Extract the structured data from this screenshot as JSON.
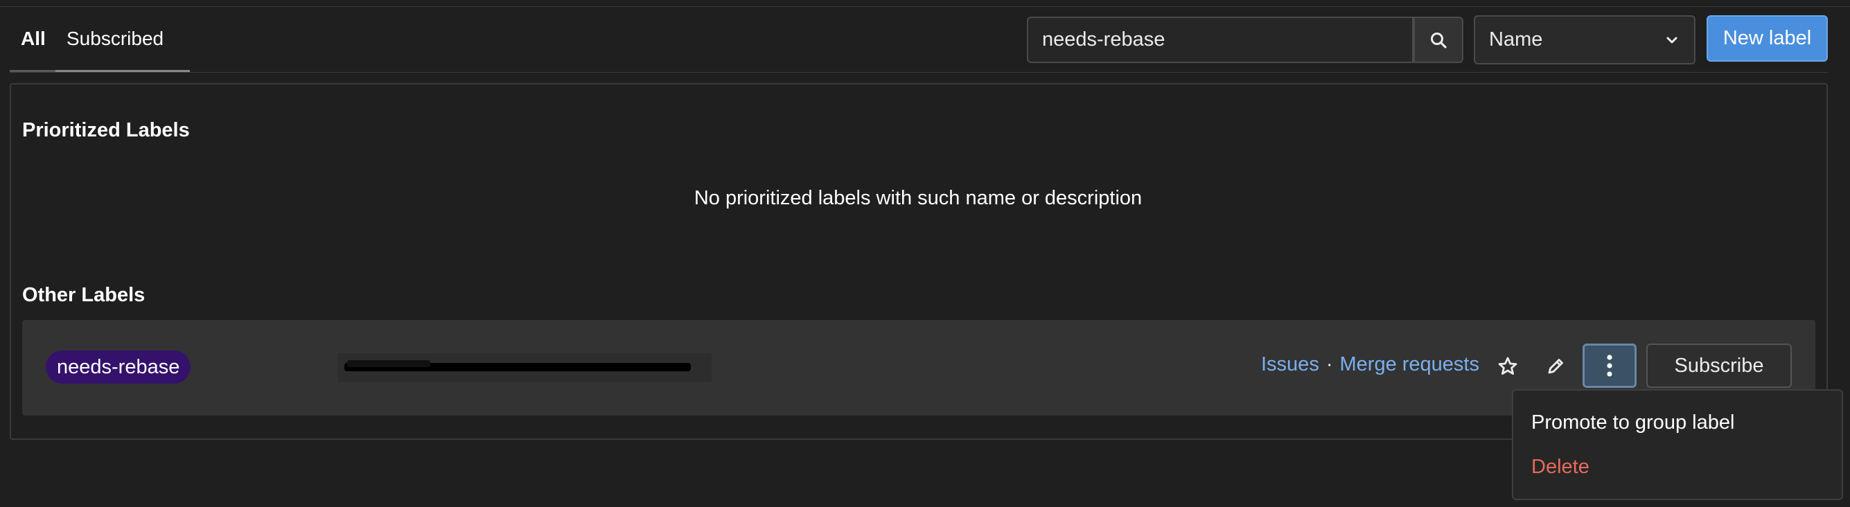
{
  "tabs": {
    "all": "All",
    "subscribed": "Subscribed"
  },
  "search": {
    "value": "needs-rebase",
    "placeholder": ""
  },
  "sort": {
    "selected": "Name"
  },
  "actions": {
    "new_label": "New label"
  },
  "prioritized": {
    "heading": "Prioritized Labels",
    "empty_message": "No prioritized labels with such name or description"
  },
  "other": {
    "heading": "Other Labels",
    "label": {
      "name": "needs-rebase",
      "color": "#34126b",
      "issues_link": "Issues",
      "separator": "·",
      "merge_requests_link": "Merge requests",
      "subscribe": "Subscribe"
    }
  },
  "menu": {
    "promote": "Promote to group label",
    "delete": "Delete"
  },
  "colors": {
    "accent": "#4a8fdd",
    "link": "#7ab0f0",
    "danger": "#e86b5a"
  },
  "icons": [
    "search-icon",
    "chevron-down-icon",
    "star-icon",
    "pencil-icon",
    "kebab-icon"
  ]
}
